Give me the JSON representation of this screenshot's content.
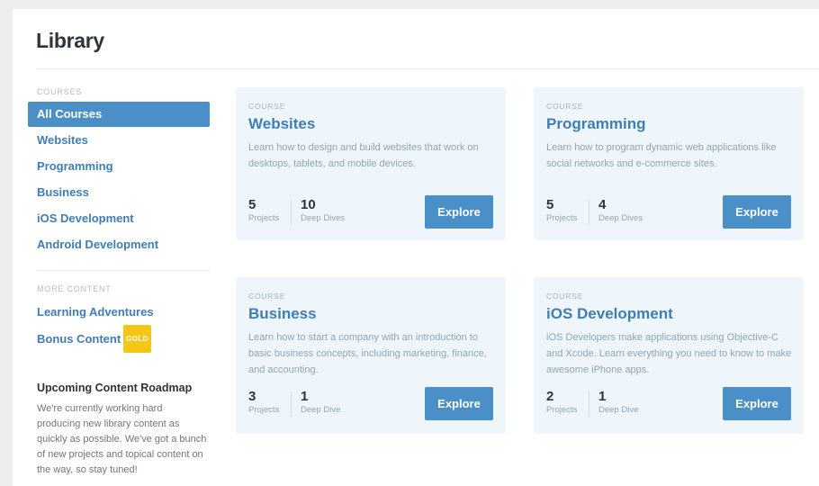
{
  "page": {
    "title": "Library"
  },
  "sidebar": {
    "courses_heading": "COURSES",
    "courses": [
      {
        "label": "All Courses",
        "active": true
      },
      {
        "label": "Websites"
      },
      {
        "label": "Programming"
      },
      {
        "label": "Business"
      },
      {
        "label": "iOS Development"
      },
      {
        "label": "Android Development"
      }
    ],
    "more_heading": "MORE CONTENT",
    "more": [
      {
        "label": "Learning Adventures"
      },
      {
        "label": "Bonus Content",
        "badge": "GOLD"
      }
    ],
    "roadmap": {
      "title": "Upcoming Content Roadmap",
      "text": "We're currently working hard producing new library content as quickly as possible. We've got a bunch of new projects and topical content on the way, so stay tuned!"
    }
  },
  "cards": [
    {
      "kicker": "COURSE",
      "title": "Websites",
      "description": "Learn how to design and build websites that work on desktops, tablets, and mobile devices.",
      "projects_count": "5",
      "projects_label": "Projects",
      "dives_count": "10",
      "dives_label": "Deep Dives",
      "button": "Explore"
    },
    {
      "kicker": "COURSE",
      "title": "Programming",
      "description": "Learn how to program dynamic web applications like social networks and e-commerce sites.",
      "projects_count": "5",
      "projects_label": "Projects",
      "dives_count": "4",
      "dives_label": "Deep Dives",
      "button": "Explore"
    },
    {
      "kicker": "COURSE",
      "title": "Business",
      "description": "Learn how to start a company with an introduction to basic business concepts, including marketing, finance, and accounting.",
      "projects_count": "3",
      "projects_label": "Projects",
      "dives_count": "1",
      "dives_label": "Deep Dive",
      "button": "Explore"
    },
    {
      "kicker": "COURSE",
      "title": "iOS Development",
      "description": "iOS Developers make applications using Objective-C and Xcode. Learn everything you need to know to make awesome iPhone apps.",
      "projects_count": "2",
      "projects_label": "Projects",
      "dives_count": "1",
      "dives_label": "Deep Dive",
      "button": "Explore"
    }
  ],
  "colors": {
    "accent": "#4a8fc8",
    "link": "#3f7db5",
    "card_bg": "#eef5fb",
    "badge_gold": "#f5c518"
  }
}
